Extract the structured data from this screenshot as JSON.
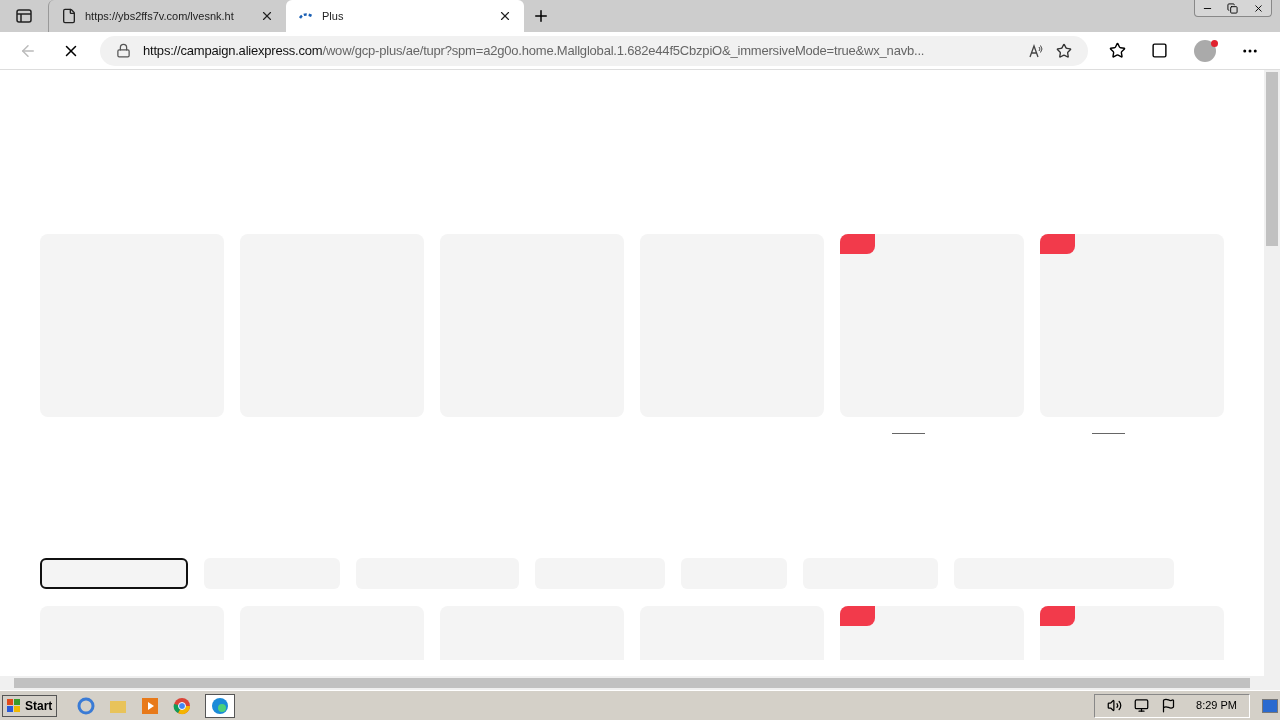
{
  "tabs": [
    {
      "kind": "page",
      "title": "https://ybs2ffs7v.com/lvesnk.ht",
      "selected": false
    },
    {
      "kind": "loading",
      "title": "Plus",
      "selected": true
    }
  ],
  "address": {
    "host": "https://campaign.aliexpress.com",
    "path": "/wow/gcp-plus/ae/tupr?spm=a2g0o.home.Mallglobal.1.682e44f5CbzpiO&_immersiveMode=true&wx_navb..."
  },
  "product_rows": [
    {
      "cards": [
        {
          "badge": false
        },
        {
          "badge": false
        },
        {
          "badge": false
        },
        {
          "badge": false
        },
        {
          "badge": true
        },
        {
          "badge": true
        }
      ]
    }
  ],
  "chips": [
    {
      "selected": true
    },
    {
      "selected": false
    },
    {
      "selected": false
    },
    {
      "selected": false
    },
    {
      "selected": false
    },
    {
      "selected": false
    },
    {
      "selected": false
    }
  ],
  "more_cards": [
    {
      "badge": false
    },
    {
      "badge": false
    },
    {
      "badge": false
    },
    {
      "badge": false
    },
    {
      "badge": true
    },
    {
      "badge": true
    }
  ],
  "taskbar": {
    "start": "Start",
    "clock": "8:29 PM"
  }
}
